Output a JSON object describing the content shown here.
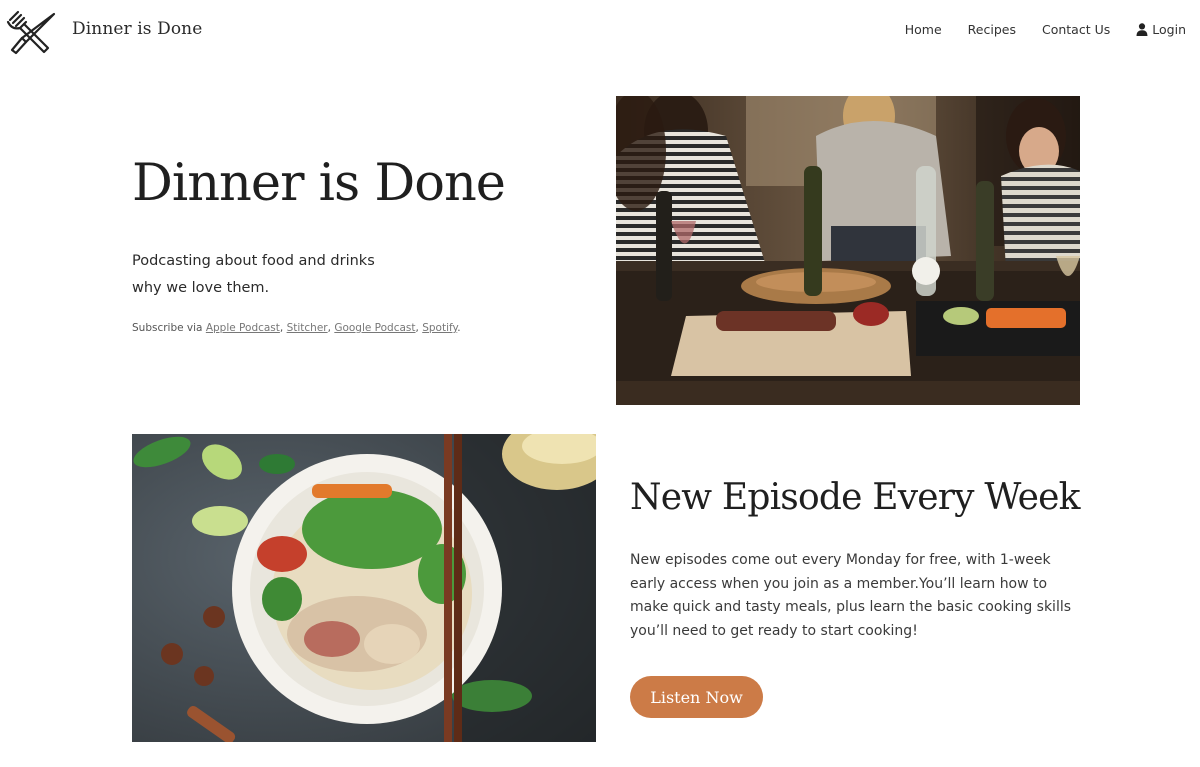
{
  "header": {
    "brand": "Dinner is Done",
    "nav": {
      "home": "Home",
      "recipes": "Recipes",
      "contact": "Contact Us",
      "login": "Login"
    }
  },
  "hero": {
    "title": "Dinner is Done",
    "subtitle_line1": "Podcasting about food and drinks",
    "subtitle_line2": "why we love them.",
    "subscribe_prefix": "Subscribe via ",
    "links": [
      "Apple Podcast",
      "Stitcher",
      "Google Podcast",
      "Spotify"
    ]
  },
  "episode": {
    "title": "New Episode Every Week",
    "body": "New episodes come out every Monday for free, with 1-week early access when you join as a member.You’ll learn how to make quick and tasty meals, plus learn the basic cooking skills you’ll need to get ready to start cooking!",
    "button": "Listen Now"
  },
  "colors": {
    "accent": "#cc7b47",
    "text": "#1f1f1f"
  },
  "icons": {
    "logo": "fork-knife-icon",
    "login": "user-icon"
  }
}
